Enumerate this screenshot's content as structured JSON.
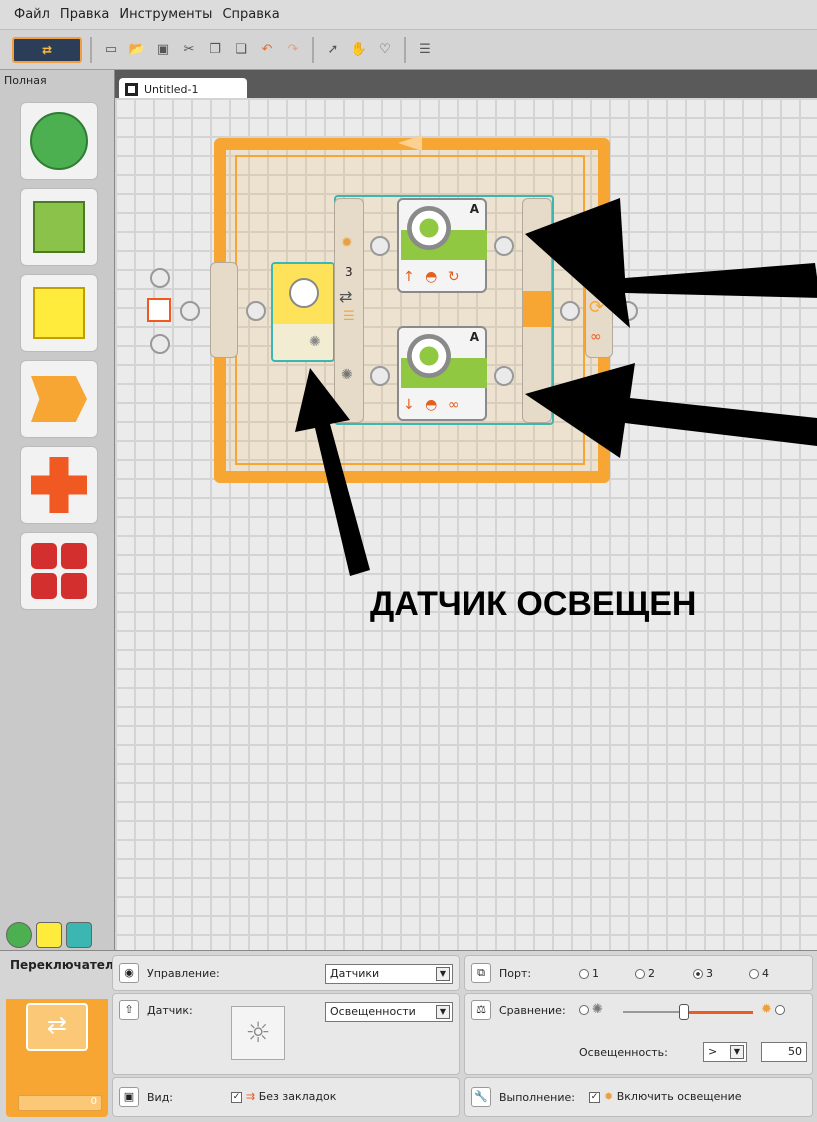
{
  "menu": [
    "Файл",
    "Правка",
    "Инструменты",
    "Справка"
  ],
  "palette": {
    "title": "Полная"
  },
  "document": {
    "tab_title": "Untitled-1"
  },
  "diagram": {
    "sensor_port": "3",
    "motor_top_port": "A",
    "motor_bottom_port": "A",
    "annotation": "ДАТЧИК ОСВЕЩЕН"
  },
  "props": {
    "block_name": "Переключатель",
    "counter": "0",
    "control_label": "Управление:",
    "control_value": "Датчики",
    "sensor_label": "Датчик:",
    "sensor_value": "Освещенности",
    "view_label": "Вид:",
    "view_value": "Без закладок",
    "port_label": "Порт:",
    "ports": [
      "1",
      "2",
      "3",
      "4"
    ],
    "port_selected": "3",
    "compare_label": "Сравнение:",
    "light_label": "Освещенность:",
    "light_op": ">",
    "light_value": "50",
    "run_label": "Выполнение:",
    "run_value": "Включить освещение"
  },
  "colors": {
    "loop": "#f7a634",
    "switch": "#3bb6b0",
    "motor": "#90c841",
    "sensor": "#fde25a"
  }
}
